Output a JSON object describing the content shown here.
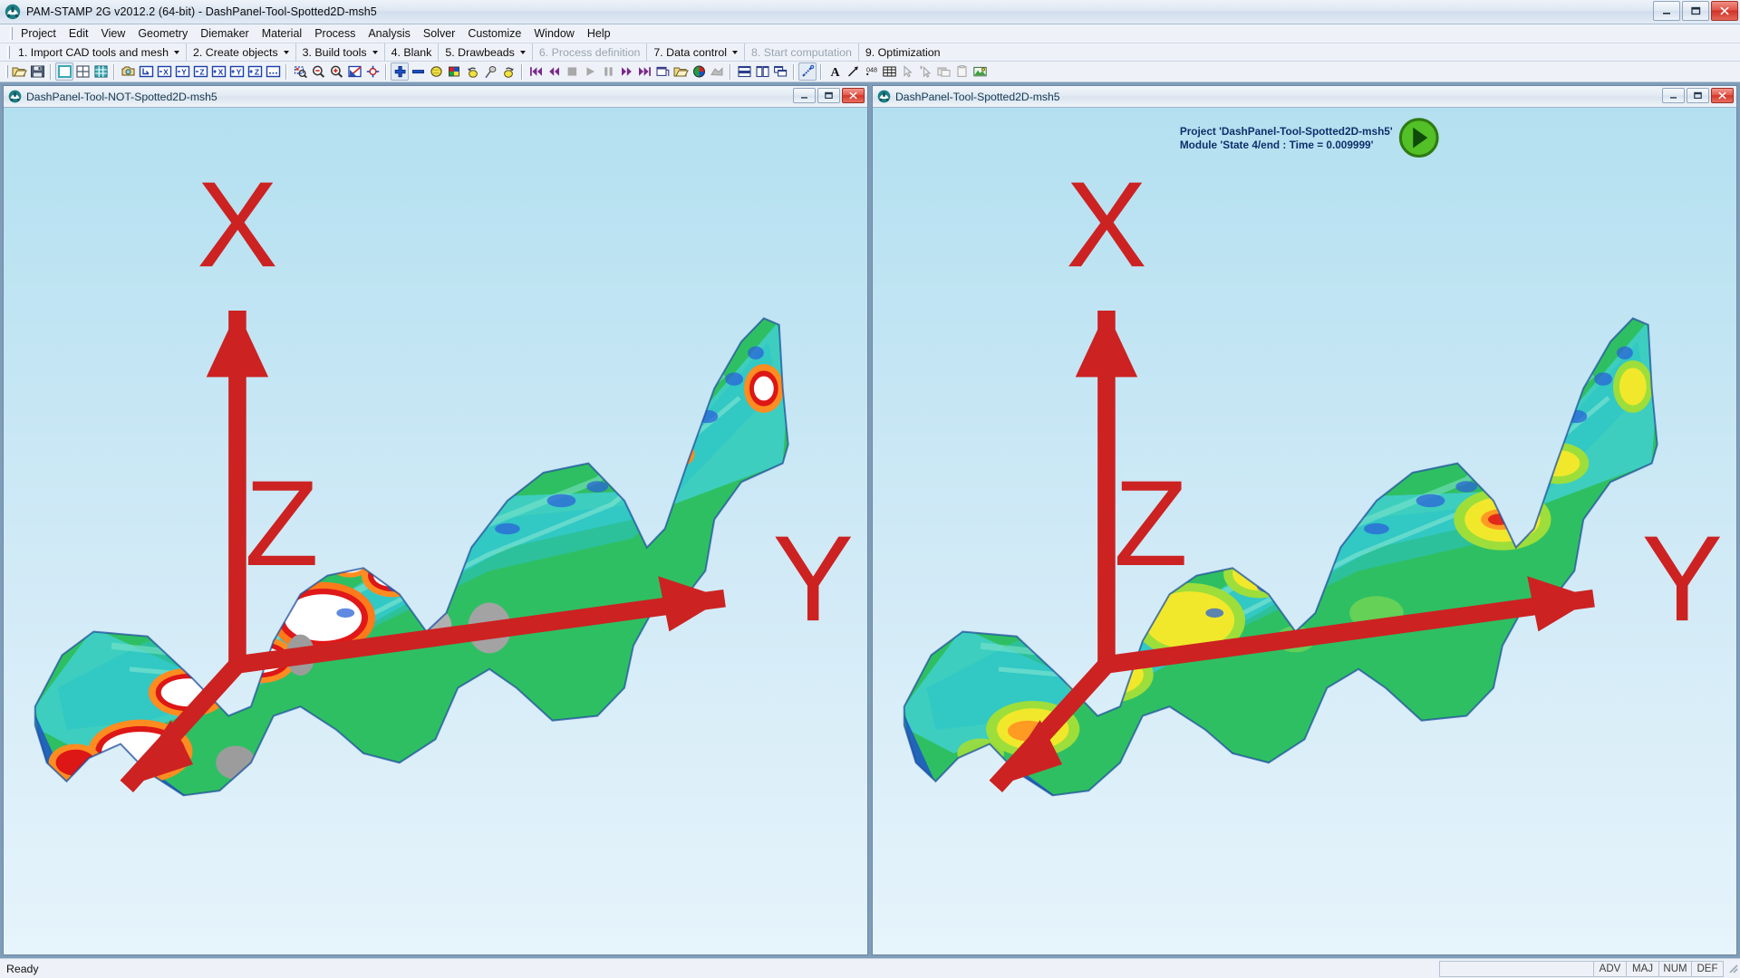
{
  "window": {
    "title": "PAM-STAMP 2G v2012.2 (64-bit) - DashPanel-Tool-Spotted2D-msh5",
    "app_icon": "pam-stamp-logo-icon",
    "controls": {
      "minimize": "minimize-icon",
      "maximize": "maximize-icon",
      "close": "close-icon"
    }
  },
  "menubar": {
    "items": [
      {
        "label": "Project"
      },
      {
        "label": "Edit"
      },
      {
        "label": "View"
      },
      {
        "label": "Geometry"
      },
      {
        "label": "Diemaker"
      },
      {
        "label": "Material"
      },
      {
        "label": "Process"
      },
      {
        "label": "Analysis"
      },
      {
        "label": "Solver"
      },
      {
        "label": "Customize"
      },
      {
        "label": "Window"
      },
      {
        "label": "Help"
      }
    ]
  },
  "stepbar": {
    "steps": [
      {
        "label": "1. Import CAD tools and mesh",
        "dropdown": true,
        "disabled": false
      },
      {
        "label": "2. Create objects",
        "dropdown": true,
        "disabled": false
      },
      {
        "label": "3. Build tools",
        "dropdown": true,
        "disabled": false
      },
      {
        "label": "4. Blank",
        "dropdown": false,
        "disabled": false
      },
      {
        "label": "5. Drawbeads",
        "dropdown": true,
        "disabled": false
      },
      {
        "label": "6. Process definition",
        "dropdown": false,
        "disabled": true
      },
      {
        "label": "7. Data control",
        "dropdown": true,
        "disabled": false
      },
      {
        "label": "8. Start computation",
        "dropdown": false,
        "disabled": true
      },
      {
        "label": "9. Optimization",
        "dropdown": false,
        "disabled": false
      }
    ]
  },
  "toolbar": {
    "groups": [
      {
        "buttons": [
          {
            "name": "open-folder-icon",
            "enabled": true
          },
          {
            "name": "save-disk-icon",
            "enabled": true
          }
        ]
      },
      {
        "buttons": [
          {
            "name": "single-view-icon",
            "enabled": true,
            "framed": true
          },
          {
            "name": "grid-view-icon",
            "enabled": true
          },
          {
            "name": "multi-grid-view-icon",
            "enabled": true
          }
        ]
      },
      {
        "buttons": [
          {
            "name": "camera-view-icon",
            "enabled": true
          },
          {
            "name": "isometric-view-icon",
            "enabled": true
          },
          {
            "name": "view-minus-x-icon",
            "enabled": true
          },
          {
            "name": "view-minus-y-icon",
            "enabled": true
          },
          {
            "name": "view-minus-z-icon",
            "enabled": true
          },
          {
            "name": "view-plus-x-icon",
            "enabled": true
          },
          {
            "name": "view-plus-y-icon",
            "enabled": true
          },
          {
            "name": "view-plus-z-icon",
            "enabled": true
          },
          {
            "name": "view-more-icon",
            "enabled": true
          }
        ]
      },
      {
        "buttons": [
          {
            "name": "zoom-window-icon",
            "enabled": true
          },
          {
            "name": "zoom-out-icon",
            "enabled": true
          },
          {
            "name": "zoom-in-icon",
            "enabled": true
          },
          {
            "name": "zoom-fit-icon",
            "enabled": true
          },
          {
            "name": "center-target-icon",
            "enabled": true
          }
        ]
      },
      {
        "buttons": [
          {
            "name": "add-plus-icon",
            "enabled": true,
            "framed": true
          },
          {
            "name": "remove-minus-icon",
            "enabled": true
          },
          {
            "name": "shaded-sphere-icon",
            "enabled": true
          },
          {
            "name": "color-palette-icon",
            "enabled": true
          },
          {
            "name": "undo-rotate-icon",
            "enabled": true
          },
          {
            "name": "probe-pick-icon",
            "enabled": true
          },
          {
            "name": "redo-rotate-icon",
            "enabled": true
          }
        ]
      },
      {
        "buttons": [
          {
            "name": "skip-first-frame-icon",
            "enabled": true
          },
          {
            "name": "rewind-icon",
            "enabled": true
          },
          {
            "name": "stop-icon",
            "enabled": false
          },
          {
            "name": "play-icon",
            "enabled": false
          },
          {
            "name": "pause-icon",
            "enabled": false
          },
          {
            "name": "fast-forward-icon",
            "enabled": true
          },
          {
            "name": "skip-last-frame-icon",
            "enabled": true
          },
          {
            "name": "new-window-icon",
            "enabled": true
          },
          {
            "name": "open-result-icon",
            "enabled": true
          },
          {
            "name": "contour-colors-icon",
            "enabled": true
          },
          {
            "name": "export-plot-icon",
            "enabled": false
          }
        ]
      },
      {
        "buttons": [
          {
            "name": "tile-horizontal-icon",
            "enabled": true
          },
          {
            "name": "tile-vertical-icon",
            "enabled": true
          },
          {
            "name": "cascade-windows-icon",
            "enabled": true
          }
        ]
      },
      {
        "buttons": [
          {
            "name": "measure-ruler-icon",
            "enabled": true,
            "framed": true
          }
        ]
      },
      {
        "buttons": [
          {
            "name": "text-annotation-icon",
            "enabled": true
          },
          {
            "name": "arrow-annotation-icon",
            "enabled": true
          },
          {
            "name": "value-label-icon",
            "enabled": true
          },
          {
            "name": "table-icon",
            "enabled": true
          },
          {
            "name": "select-cursor-icon",
            "enabled": false
          },
          {
            "name": "select-multi-icon",
            "enabled": false
          },
          {
            "name": "copy-window-icon",
            "enabled": false
          },
          {
            "name": "paste-window-icon",
            "enabled": false
          },
          {
            "name": "capture-image-icon",
            "enabled": true
          }
        ]
      }
    ]
  },
  "mdi": {
    "windows": [
      {
        "title": "DashPanel-Tool-NOT-Spotted2D-msh5",
        "icon": "pam-stamp-logo-icon",
        "active": false,
        "controls": {
          "minimize": "minimize-icon",
          "maximize": "maximize-icon",
          "close": "close-icon"
        },
        "project_info": null,
        "axis_gizmo": {
          "x": "X",
          "y": "Y",
          "z": "Z"
        }
      },
      {
        "title": "DashPanel-Tool-Spotted2D-msh5",
        "icon": "pam-stamp-logo-icon",
        "active": true,
        "controls": {
          "minimize": "minimize-icon",
          "maximize": "maximize-icon",
          "close": "close-icon"
        },
        "project_info": {
          "line1": "Project 'DashPanel-Tool-Spotted2D-msh5'",
          "line2": "Module 'State 4/end : Time = 0.009999'",
          "left_icon": "open-folder-icon",
          "back_icon": "previous-state-arrow-icon",
          "forward_icon": "next-state-arrow-icon"
        },
        "axis_gizmo": {
          "x": "X",
          "y": "Y",
          "z": "Z"
        }
      }
    ]
  },
  "statusbar": {
    "message": "Ready",
    "progress_value": "",
    "indicators": [
      {
        "label": "ADV"
      },
      {
        "label": "MAJ"
      },
      {
        "label": "NUM"
      },
      {
        "label": "DEF"
      }
    ]
  },
  "colors": {
    "mdi_background": "#7f9db9",
    "viewport_top": "#b9e3f2",
    "viewport_bottom": "#dff0fa",
    "accent_blue": "#0b2f6b",
    "close_red": "#cf3326",
    "contour_red": "#e02020",
    "contour_orange": "#ff9a1f",
    "contour_yellow": "#f4ea2a",
    "contour_green": "#22b14c",
    "contour_cyan": "#26d0d8",
    "contour_blue": "#2060d0",
    "contour_white": "#ffffff",
    "contour_grey": "#9e9e9e"
  }
}
